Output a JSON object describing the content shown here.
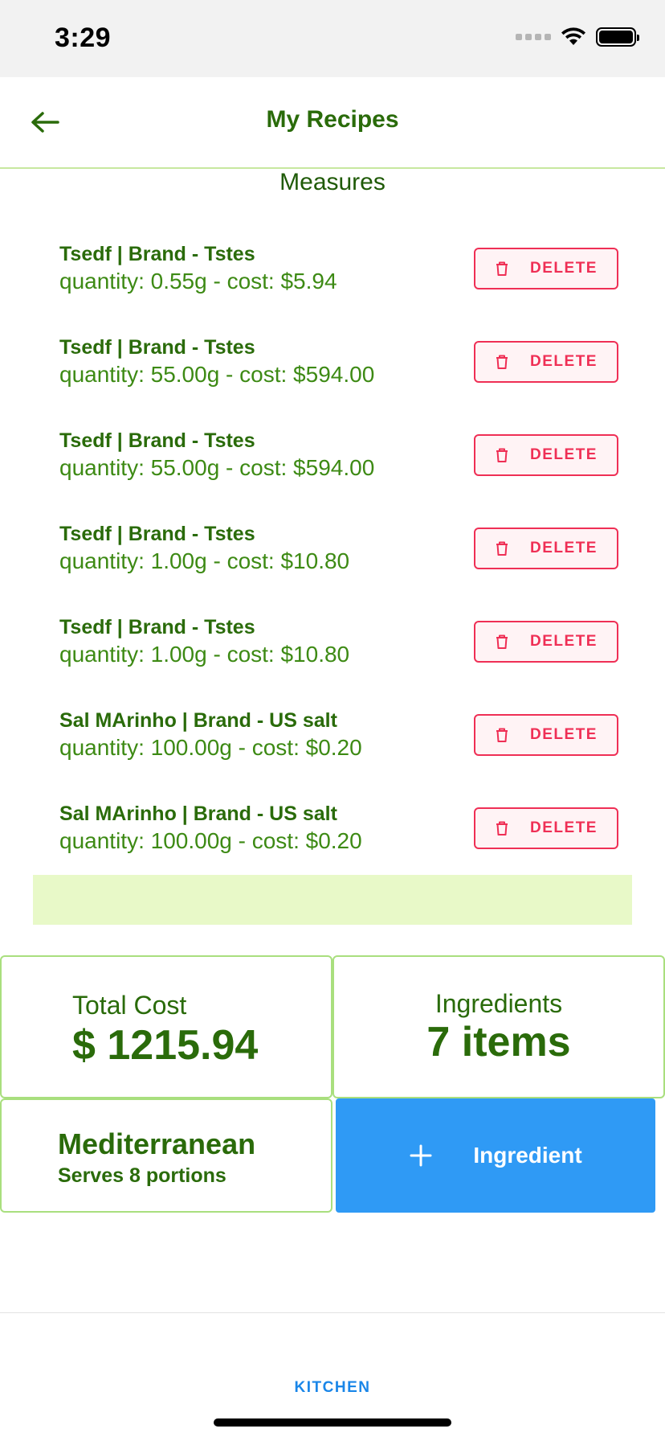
{
  "status": {
    "time": "3:29"
  },
  "header": {
    "title": "My Recipes"
  },
  "section_title": "Measures",
  "measures": [
    {
      "name": "Tsedf | Brand - Tstes",
      "detail": "quantity: 0.55g - cost: $5.94",
      "delete_label": "DELETE"
    },
    {
      "name": "Tsedf | Brand - Tstes",
      "detail": "quantity: 55.00g - cost: $594.00",
      "delete_label": "DELETE"
    },
    {
      "name": "Tsedf | Brand - Tstes",
      "detail": "quantity: 55.00g - cost: $594.00",
      "delete_label": "DELETE"
    },
    {
      "name": "Tsedf | Brand - Tstes",
      "detail": "quantity: 1.00g - cost: $10.80",
      "delete_label": "DELETE"
    },
    {
      "name": "Tsedf | Brand - Tstes",
      "detail": "quantity: 1.00g - cost: $10.80",
      "delete_label": "DELETE"
    },
    {
      "name": "Sal MArinho | Brand - US salt",
      "detail": "quantity: 100.00g - cost: $0.20",
      "delete_label": "DELETE"
    },
    {
      "name": "Sal MArinho | Brand - US salt",
      "detail": "quantity: 100.00g - cost: $0.20",
      "delete_label": "DELETE"
    }
  ],
  "summary": {
    "cost_label": "Total Cost",
    "cost_value": "$ 1215.94",
    "ingredients_label": "Ingredients",
    "ingredients_value": "7 items",
    "cuisine": "Mediterranean",
    "serves": "Serves 8 portions"
  },
  "add_button": {
    "label": "Ingredient",
    "icon": "plus-icon"
  },
  "tab_bar": {
    "kitchen_label": "KITCHEN"
  },
  "colors": {
    "primary_green": "#2a6b0a",
    "delete_red": "#ef2f55",
    "accent_blue": "#2f9af5",
    "band_green": "#e8f9c8"
  }
}
